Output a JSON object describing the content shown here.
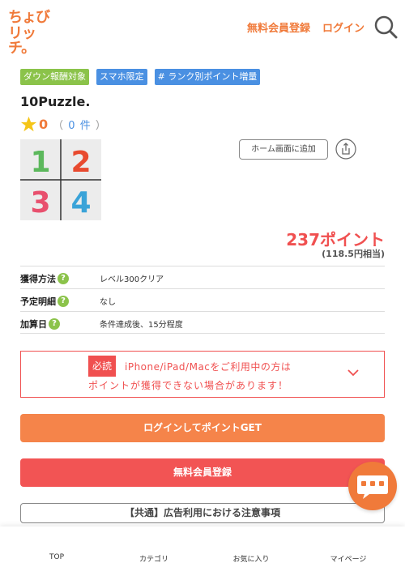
{
  "header": {
    "logo_line1": "ちょび",
    "logo_line2": "リッチ。",
    "register_label": "無料会員登録",
    "login_label": "ログイン"
  },
  "tags": [
    "ダウン報酬対象",
    "スマホ限定",
    "# ランク別ポイント増量"
  ],
  "app": {
    "title": "10Puzzle.",
    "rating_score": "0",
    "rating_open": "（",
    "rating_count": "0 件",
    "rating_close": "）",
    "icon_digits": [
      "1",
      "2",
      "3",
      "4"
    ]
  },
  "home_add_label": "ホーム画面に追加",
  "points": {
    "value": "237ポイント",
    "yen": "(118.5円相当)"
  },
  "info": [
    {
      "label": "獲得方法",
      "value": "レベル300クリア"
    },
    {
      "label": "予定明細",
      "value": "なし"
    },
    {
      "label": "加算日",
      "value": "条件達成後、15分程度"
    }
  ],
  "help_glyph": "?",
  "notice": {
    "badge": "必読",
    "line1": "iPhone/iPad/Macをご利用中の方は",
    "line2": "ポイントが獲得できない場合があります！"
  },
  "buttons": {
    "login": "ログインしてポイントGET",
    "register": "無料会員登録"
  },
  "caution_label": "【共通】広告利用における注意事項",
  "bottom_nav": [
    "TOP",
    "カテゴリ",
    "お気に入り",
    "マイページ"
  ],
  "colors": {
    "brand": "#f07a3a",
    "alert": "#f05050",
    "tag_green": "#8bc34a",
    "tag_blue": "#4a90e2"
  },
  "icons": [
    "search-icon",
    "star-icon",
    "share-icon",
    "help-icon",
    "chevron-down-icon",
    "chat-icon"
  ]
}
